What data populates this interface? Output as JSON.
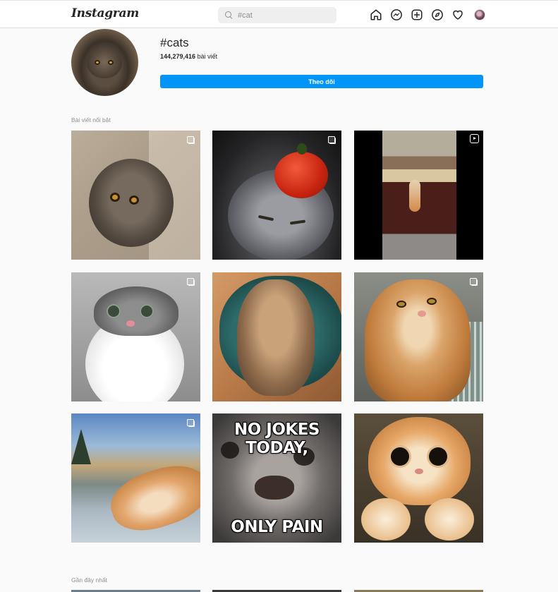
{
  "header": {
    "logo": "Instagram",
    "search": {
      "placeholder": "#cat"
    }
  },
  "nav_icons": [
    "home-icon",
    "messenger-icon",
    "new-post-icon",
    "explore-icon",
    "activity-heart-icon",
    "profile-avatar"
  ],
  "tag": {
    "title": "#cats",
    "post_count": "144,279,416",
    "post_suffix": " bài viết",
    "follow_label": "Theo dõi"
  },
  "sections": {
    "top": "Bài viết nổi bật",
    "recent": "Gần đây nhất"
  },
  "posts": [
    {
      "subject": "wet grey persian cat",
      "badge": "multi-icon"
    },
    {
      "subject": "grey cat with tomato on head",
      "badge": "multi-icon"
    },
    {
      "subject": "cat on bakery counter video",
      "badge": "reel-icon"
    },
    {
      "subject": "white and grey kitten looking up",
      "badge": "multi-icon"
    },
    {
      "subject": "tabby cat lying on green chair",
      "badge": "none"
    },
    {
      "subject": "ginger cat selfie",
      "badge": "multi-icon"
    },
    {
      "subject": "ginger cat in frosty grass",
      "badge": "multi-icon"
    },
    {
      "subject": "cat meme",
      "badge": "none",
      "meme_top": "NO JOKES TODAY,",
      "meme_bottom": "ONLY PAIN"
    },
    {
      "subject": "ginger cat with big eyes",
      "badge": "none"
    }
  ]
}
